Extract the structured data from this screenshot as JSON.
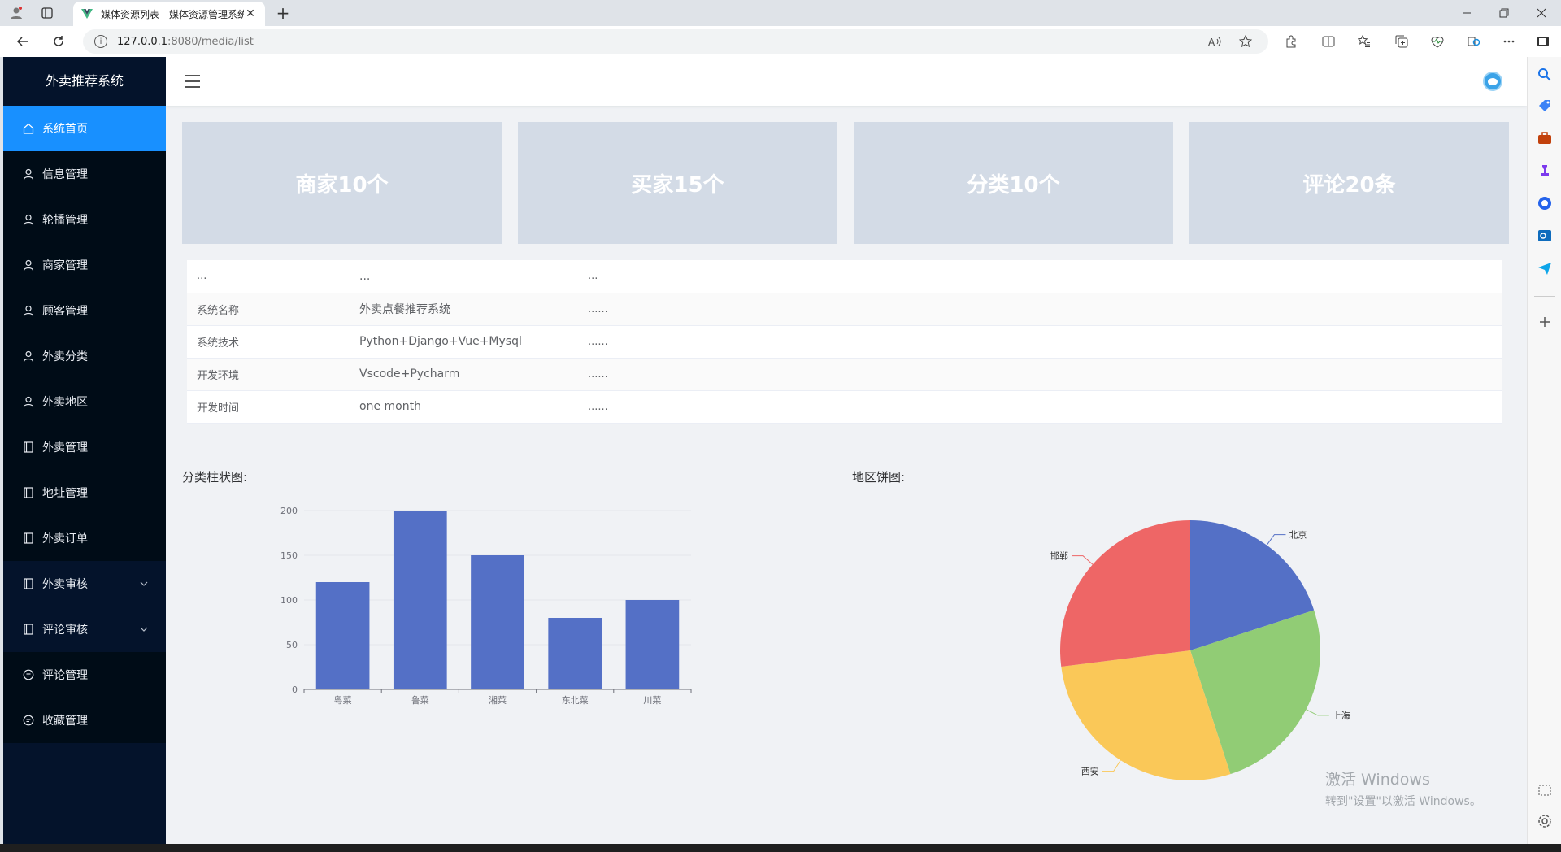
{
  "browser": {
    "tab_title": "媒体资源列表 - 媒体资源管理系统",
    "tab_close": "✕",
    "new_tab": "+",
    "url_host": "127.0.0.1",
    "url_rest": ":8080/media/list"
  },
  "sidebar": {
    "brand": "外卖推荐系统",
    "items": [
      {
        "label": "系统首页",
        "icon": "home-icon",
        "active": true
      },
      {
        "label": "信息管理",
        "icon": "user-icon"
      },
      {
        "label": "轮播管理",
        "icon": "user-icon"
      },
      {
        "label": "商家管理",
        "icon": "user-icon"
      },
      {
        "label": "顾客管理",
        "icon": "user-icon"
      },
      {
        "label": "外卖分类",
        "icon": "user-icon"
      },
      {
        "label": "外卖地区",
        "icon": "user-icon"
      },
      {
        "label": "外卖管理",
        "icon": "document-icon"
      },
      {
        "label": "地址管理",
        "icon": "document-icon"
      },
      {
        "label": "外卖订单",
        "icon": "document-icon"
      },
      {
        "label": "外卖审核",
        "icon": "document-icon",
        "expandable": true
      },
      {
        "label": "评论审核",
        "icon": "document-icon",
        "expandable": true
      },
      {
        "label": "评论管理",
        "icon": "chat-icon"
      },
      {
        "label": "收藏管理",
        "icon": "chat-icon"
      }
    ]
  },
  "cards": [
    "商家10个",
    "买家15个",
    "分类10个",
    "评论20条"
  ],
  "info_table": [
    [
      "...",
      "...",
      "..."
    ],
    [
      "系统名称",
      "外卖点餐推荐系统",
      "......"
    ],
    [
      "系统技术",
      "Python+Django+Vue+Mysql",
      "......"
    ],
    [
      "开发环境",
      "Vscode+Pycharm",
      "......"
    ],
    [
      "开发时间",
      "one month",
      "......"
    ]
  ],
  "charts": {
    "bar_title": "分类柱状图:",
    "pie_title": "地区饼图:"
  },
  "chart_data": [
    {
      "type": "bar",
      "categories": [
        "粤菜",
        "鲁菜",
        "湘菜",
        "东北菜",
        "川菜"
      ],
      "values": [
        120,
        200,
        150,
        80,
        100
      ],
      "ylim": [
        0,
        200
      ],
      "yticks": [
        0,
        50,
        100,
        150,
        200
      ],
      "color": "#5470c6",
      "grid": true
    },
    {
      "type": "pie",
      "labels": [
        "北京",
        "上海",
        "西安",
        "邯郸"
      ],
      "values": [
        20,
        25,
        28,
        27
      ],
      "colors": [
        "#5470c6",
        "#91cc75",
        "#fac858",
        "#ee6666"
      ]
    }
  ],
  "watermark": {
    "line1": "激活 Windows",
    "line2": "转到\"设置\"以激活 Windows。"
  },
  "colors": {
    "sidebar_bg": "#04132b",
    "active": "#1890ff",
    "card_bg": "#d3dbe6"
  }
}
